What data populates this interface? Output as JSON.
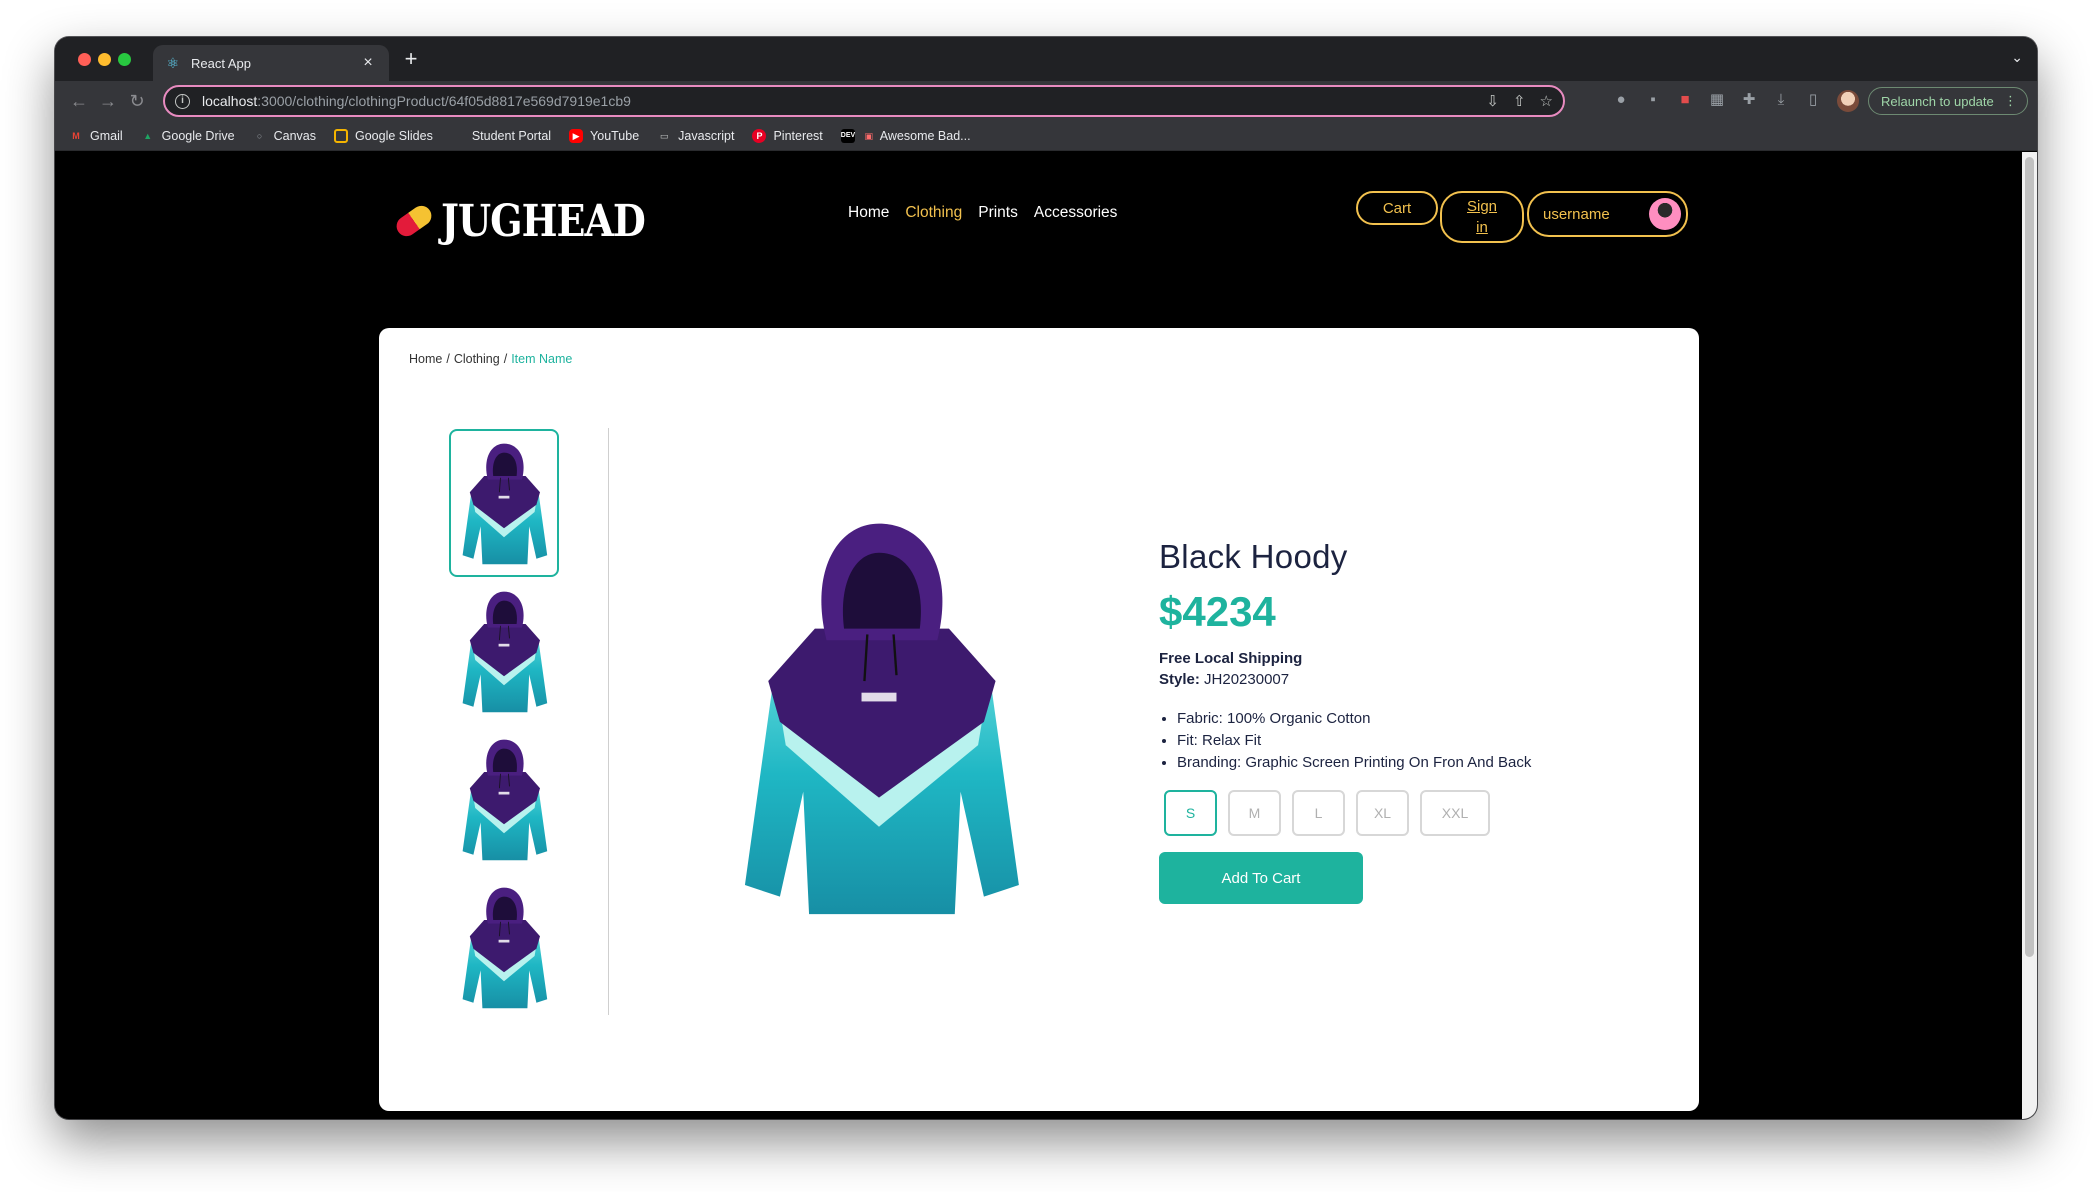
{
  "browser": {
    "tab_title": "React App",
    "url_host": "localhost",
    "url_path": ":3000/clothing/clothingProduct/64f05d8817e569d7919e1cb9",
    "relaunch_label": "Relaunch to update",
    "bookmarks": [
      {
        "label": "Gmail",
        "icon": "gmail-icon",
        "color": "#ea4335"
      },
      {
        "label": "Google Drive",
        "icon": "google-drive-icon",
        "color": "#1fa463"
      },
      {
        "label": "Canvas",
        "icon": "canvas-icon",
        "color": "#9aa0a6"
      },
      {
        "label": "Google Slides",
        "icon": "google-slides-icon",
        "color": "#f4b400"
      },
      {
        "label": "Student Portal",
        "icon": "student-portal-icon",
        "color": "#35363a"
      },
      {
        "label": "YouTube",
        "icon": "youtube-icon",
        "color": "#ff0000"
      },
      {
        "label": "Javascript",
        "icon": "folder-icon",
        "color": "#9aa0a6"
      },
      {
        "label": "Pinterest",
        "icon": "pinterest-icon",
        "color": "#e60023"
      },
      {
        "label": "Awesome Bad...",
        "icon": "dev-icon",
        "color": "#000000"
      }
    ]
  },
  "site": {
    "logo_text": "JUGHEAD",
    "nav": [
      {
        "label": "Home",
        "active": false
      },
      {
        "label": "Clothing",
        "active": true
      },
      {
        "label": "Prints",
        "active": false
      },
      {
        "label": "Accessories",
        "active": false
      }
    ],
    "cart_label": "Cart",
    "signin_label": "Sign in",
    "username": "username"
  },
  "breadcrumb": {
    "home": "Home",
    "sep1": "/",
    "category": "Clothing",
    "sep2": "/",
    "current": "Item Name"
  },
  "product": {
    "name": "Black Hoody",
    "price": "$4234",
    "shipping": "Free Local Shipping",
    "style_label": "Style:",
    "style_value": "JH20230007",
    "features": [
      "Fabric: 100% Organic Cotton",
      "Fit: Relax Fit",
      "Branding: Graphic Screen Printing On Fron And Back"
    ],
    "sizes": [
      "S",
      "M",
      "L",
      "XL",
      "XXL"
    ],
    "selected_size": "S",
    "add_to_cart_label": "Add To Cart",
    "thumbnail_count": 4,
    "selected_thumbnail": 0
  },
  "colors": {
    "accent": "#1eb39e",
    "nav_active": "#f2c14e",
    "text_dark": "#1c2340",
    "hoodie_purple": "#3d1a6e",
    "hoodie_teal": "#1fb7c4"
  }
}
